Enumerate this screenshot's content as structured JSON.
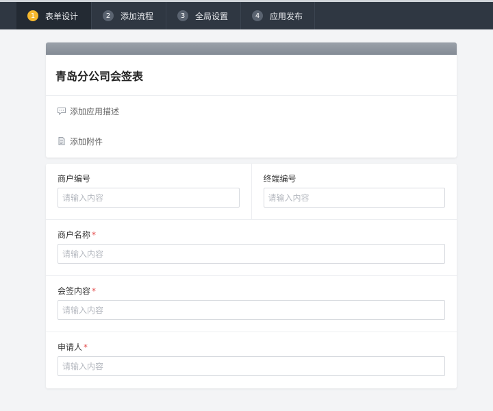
{
  "nav": {
    "steps": [
      {
        "num": "1",
        "label": "表单设计"
      },
      {
        "num": "2",
        "label": "添加流程"
      },
      {
        "num": "3",
        "label": "全局设置"
      },
      {
        "num": "4",
        "label": "应用发布"
      }
    ],
    "active_step": "1"
  },
  "form": {
    "title": "青岛分公司会签表",
    "add_description": "添加应用描述",
    "add_attachment": "添加附件",
    "fields": {
      "merchant_no": {
        "label": "商户编号",
        "placeholder": "请输入内容"
      },
      "terminal_no": {
        "label": "终端编号",
        "placeholder": "请输入内容"
      },
      "merchant_name": {
        "label": "商户名称",
        "required": "*",
        "placeholder": "请输入内容"
      },
      "sign_content": {
        "label": "会签内容",
        "required": "*",
        "placeholder": "请输入内容"
      },
      "applicant": {
        "label": "申请人",
        "required": "*",
        "placeholder": "请输入内容"
      }
    }
  },
  "colors": {
    "nav_bg": "#2f3742",
    "active_step_bg": "#232a33",
    "active_badge": "#f5b82e",
    "required": "#e34b4b"
  },
  "icons": {
    "add_description": "comment-icon",
    "add_attachment": "document-icon"
  }
}
